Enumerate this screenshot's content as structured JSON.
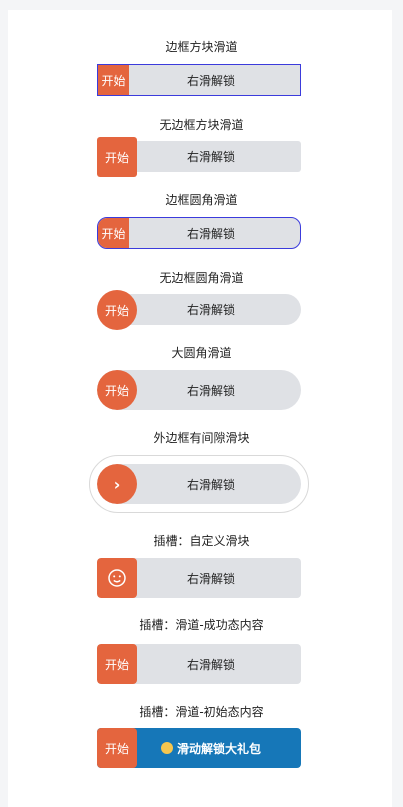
{
  "demos": {
    "d1": {
      "title": "边框方块滑道",
      "label": "右滑解锁",
      "handle": "开始"
    },
    "d2": {
      "title": "无边框方块滑道",
      "label": "右滑解锁",
      "handle": "开始"
    },
    "d3": {
      "title": "边框圆角滑道",
      "label": "右滑解锁",
      "handle": "开始"
    },
    "d4": {
      "title": "无边框圆角滑道",
      "label": "右滑解锁",
      "handle": "开始"
    },
    "d5": {
      "title": "大圆角滑道",
      "label": "右滑解锁",
      "handle": "开始"
    },
    "d6": {
      "title": "外边框有间隙滑块",
      "label": "右滑解锁",
      "handle_icon": "chevron-right-icon"
    },
    "d7": {
      "title": "插槽：自定义滑块",
      "label": "右滑解锁",
      "handle_icon": "smiley-face-icon"
    },
    "d8": {
      "title": "插槽：滑道-成功态内容",
      "label": "右滑解锁",
      "handle": "开始"
    },
    "d9": {
      "title": "插槽：滑道-初始态内容",
      "label": "滑动解锁大礼包",
      "handle": "开始",
      "label_icon": "smiley-emoji-icon"
    }
  },
  "colors": {
    "handle": "#e4653e",
    "track": "#dfe1e5",
    "border_blue": "#3b3bdc",
    "track_blue": "#1677b8"
  }
}
